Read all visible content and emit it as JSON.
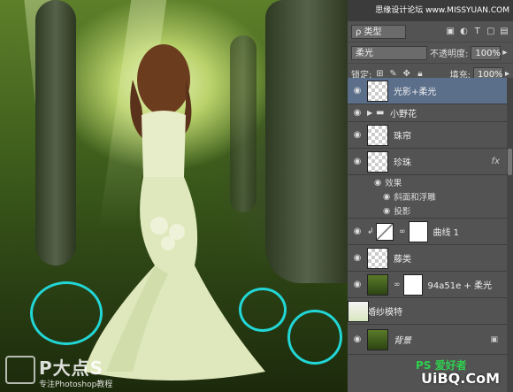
{
  "site_header": "思缘设计论坛 www.MISSYUAN.COM",
  "panel": {
    "kind_filter": "ρ 类型",
    "blend_mode": "柔光",
    "opacity_label": "不透明度:",
    "opacity_value": "100%",
    "lock_label": "锁定:",
    "fill_label": "填充:",
    "fill_value": "100%",
    "layers": [
      {
        "name": "光影+柔光",
        "selected": true
      },
      {
        "name": "小野花",
        "type": "group"
      },
      {
        "name": "珠帘"
      },
      {
        "name": "珍珠",
        "fx": "fx"
      },
      {
        "name": "曲线 1",
        "type": "adjustment"
      },
      {
        "name": "藤类"
      },
      {
        "name": "94a51e + 柔光"
      },
      {
        "name": "婚纱模特"
      },
      {
        "name": "背景",
        "locked": true
      }
    ],
    "effects": {
      "title": "效果",
      "items": [
        "斜面和浮雕",
        "投影"
      ]
    }
  },
  "watermark": {
    "logo": "P大点S",
    "sub": "专注Photoshop教程"
  },
  "bottom_right": {
    "ps": "PS 爱好者",
    "site": "UiBQ.CoM"
  }
}
